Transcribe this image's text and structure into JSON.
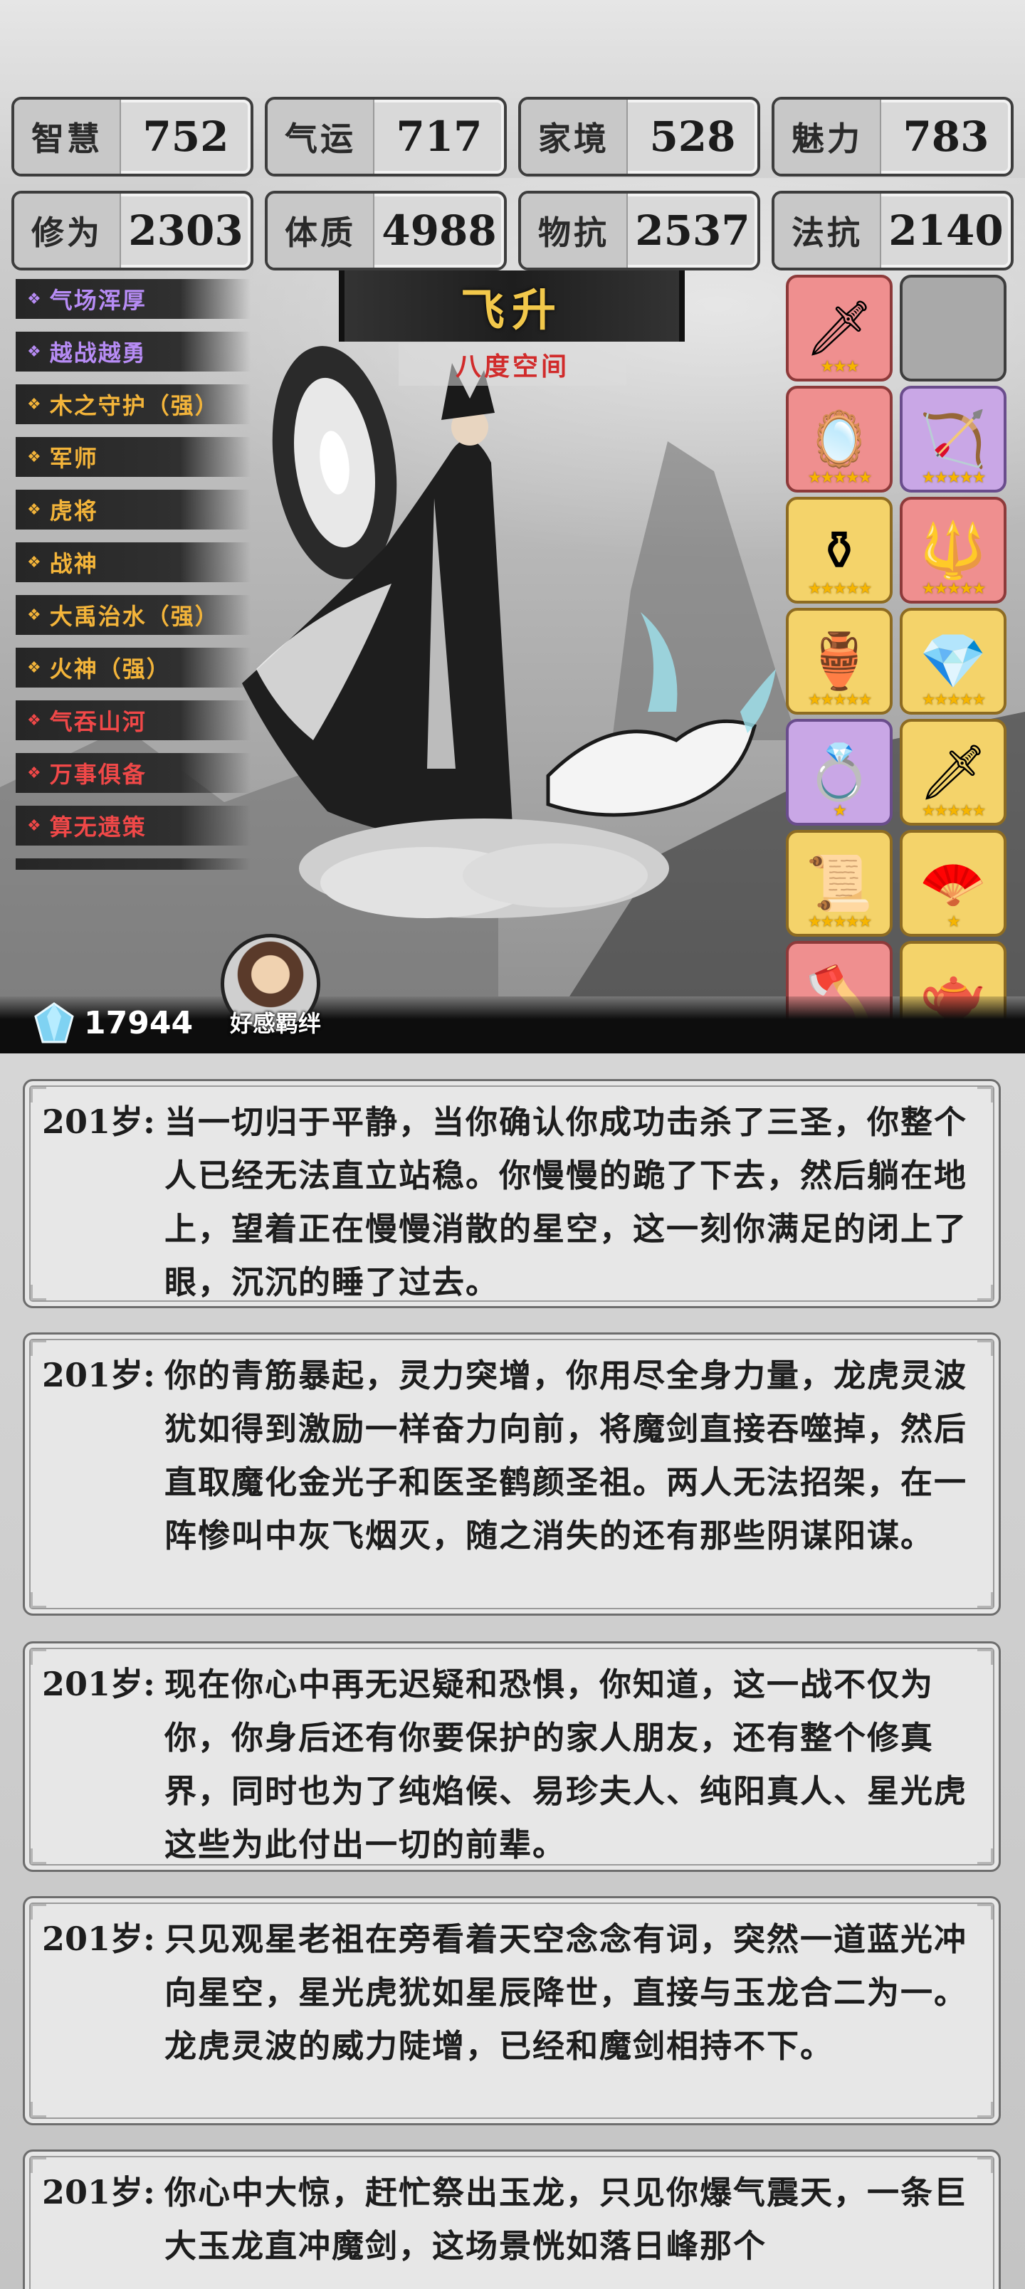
{
  "stats": [
    {
      "label": "智慧",
      "value": "752"
    },
    {
      "label": "气运",
      "value": "717"
    },
    {
      "label": "家境",
      "value": "528"
    },
    {
      "label": "魅力",
      "value": "783"
    },
    {
      "label": "修为",
      "value": "2303"
    },
    {
      "label": "体质",
      "value": "4988"
    },
    {
      "label": "物抗",
      "value": "2537"
    },
    {
      "label": "法抗",
      "value": "2140"
    }
  ],
  "traits": [
    {
      "label": "气场浑厚",
      "color": "#b78cf5"
    },
    {
      "label": "越战越勇",
      "color": "#b78cf5"
    },
    {
      "label": "木之守护（强）",
      "color": "#f3b43a"
    },
    {
      "label": "军师",
      "color": "#f3b43a"
    },
    {
      "label": "虎将",
      "color": "#f3b43a"
    },
    {
      "label": "战神",
      "color": "#f3b43a"
    },
    {
      "label": "大禹治水（强）",
      "color": "#f3b43a"
    },
    {
      "label": "火神（强）",
      "color": "#f3b43a"
    },
    {
      "label": "气吞山河",
      "color": "#f04848"
    },
    {
      "label": "万事俱备",
      "color": "#f04848"
    },
    {
      "label": "算无遗策",
      "color": "#f04848"
    },
    {
      "label": "",
      "color": "#f04848"
    }
  ],
  "stage": {
    "title": "飞升",
    "realm": "八度空间"
  },
  "equipment": [
    {
      "rarity": "red",
      "icon": "sword-icon",
      "glyph": "🗡",
      "stars": "★★★"
    },
    {
      "rarity": "empty",
      "icon": "empty-slot-icon",
      "glyph": "",
      "stars": ""
    },
    {
      "rarity": "red",
      "icon": "mirror-icon",
      "glyph": "🪞",
      "stars": "★★★★★"
    },
    {
      "rarity": "purple",
      "icon": "bow-icon",
      "glyph": "🏹",
      "stars": "★★★★★"
    },
    {
      "rarity": "gold",
      "icon": "cauldron-icon",
      "glyph": "⚱",
      "stars": "★★★★★"
    },
    {
      "rarity": "red",
      "icon": "spear-icon",
      "glyph": "🔱",
      "stars": "★★★★★"
    },
    {
      "rarity": "gold",
      "icon": "gourd-icon",
      "glyph": "🏺",
      "stars": "★★★★★"
    },
    {
      "rarity": "gold",
      "icon": "crystal-icon",
      "glyph": "💎",
      "stars": "★★★★★"
    },
    {
      "rarity": "purple",
      "icon": "ring-icon",
      "glyph": "💍",
      "stars": "★"
    },
    {
      "rarity": "gold",
      "icon": "dagger-icon",
      "glyph": "🗡",
      "stars": "★★★★★"
    },
    {
      "rarity": "gold",
      "icon": "scroll-icon",
      "glyph": "📜",
      "stars": "★★★★★"
    },
    {
      "rarity": "gold",
      "icon": "fan-icon",
      "glyph": "🪭",
      "stars": "★"
    },
    {
      "rarity": "red",
      "icon": "axe-icon",
      "glyph": "🪓",
      "stars": "★★★★★"
    },
    {
      "rarity": "gold",
      "icon": "teapot-icon",
      "glyph": "🫖",
      "stars": "★"
    }
  ],
  "currency": {
    "amount": "17944"
  },
  "bond_label": "好感羁绊",
  "log": [
    {
      "age": "201岁:",
      "text": "当一切归于平静，当你确认你成功击杀了三圣，你整个人已经无法直立站稳。你慢慢的跪了下去，然后躺在地上，望着正在慢慢消散的星空，这一刻你满足的闭上了眼，沉沉的睡了过去。"
    },
    {
      "age": "201岁:",
      "text": "你的青筋暴起，灵力突增，你用尽全身力量，龙虎灵波犹如得到激励一样奋力向前，将魔剑直接吞噬掉，然后直取魔化金光子和医圣鹤颜圣祖。两人无法招架，在一阵惨叫中灰飞烟灭，随之消失的还有那些阴谋阳谋。"
    },
    {
      "age": "201岁:",
      "text": "现在你心中再无迟疑和恐惧，你知道，这一战不仅为你，你身后还有你要保护的家人朋友，还有整个修真界，同时也为了纯焰候、易珍夫人、纯阳真人、星光虎这些为此付出一切的前辈。"
    },
    {
      "age": "201岁:",
      "text": "只见观星老祖在旁看着天空念念有词，突然一道蓝光冲向星空，星光虎犹如星辰降世，直接与玉龙合二为一。龙虎灵波的威力陡增，已经和魔剑相持不下。"
    },
    {
      "age": "201岁:",
      "text": "你心中大惊，赶忙祭出玉龙，只见你爆气震天，一条巨大玉龙直冲魔剑，这场景恍如落日峰那个"
    }
  ]
}
